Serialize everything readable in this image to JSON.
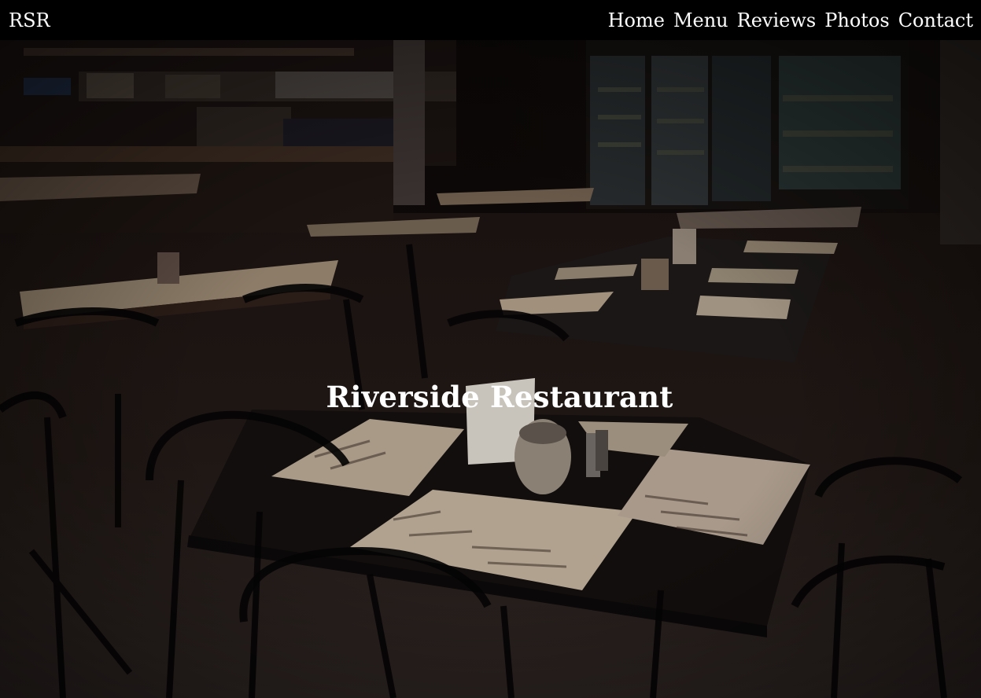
{
  "nav": {
    "brand": "RSR",
    "links": [
      "Home",
      "Menu",
      "Reviews",
      "Photos",
      "Contact"
    ]
  },
  "hero": {
    "title": "Riverside Restaurant",
    "image_icon": "restaurant-interior-photo"
  },
  "colors": {
    "navbar_bg": "#000000",
    "nav_text": "#ffffff",
    "hero_title": "#ffffff"
  }
}
